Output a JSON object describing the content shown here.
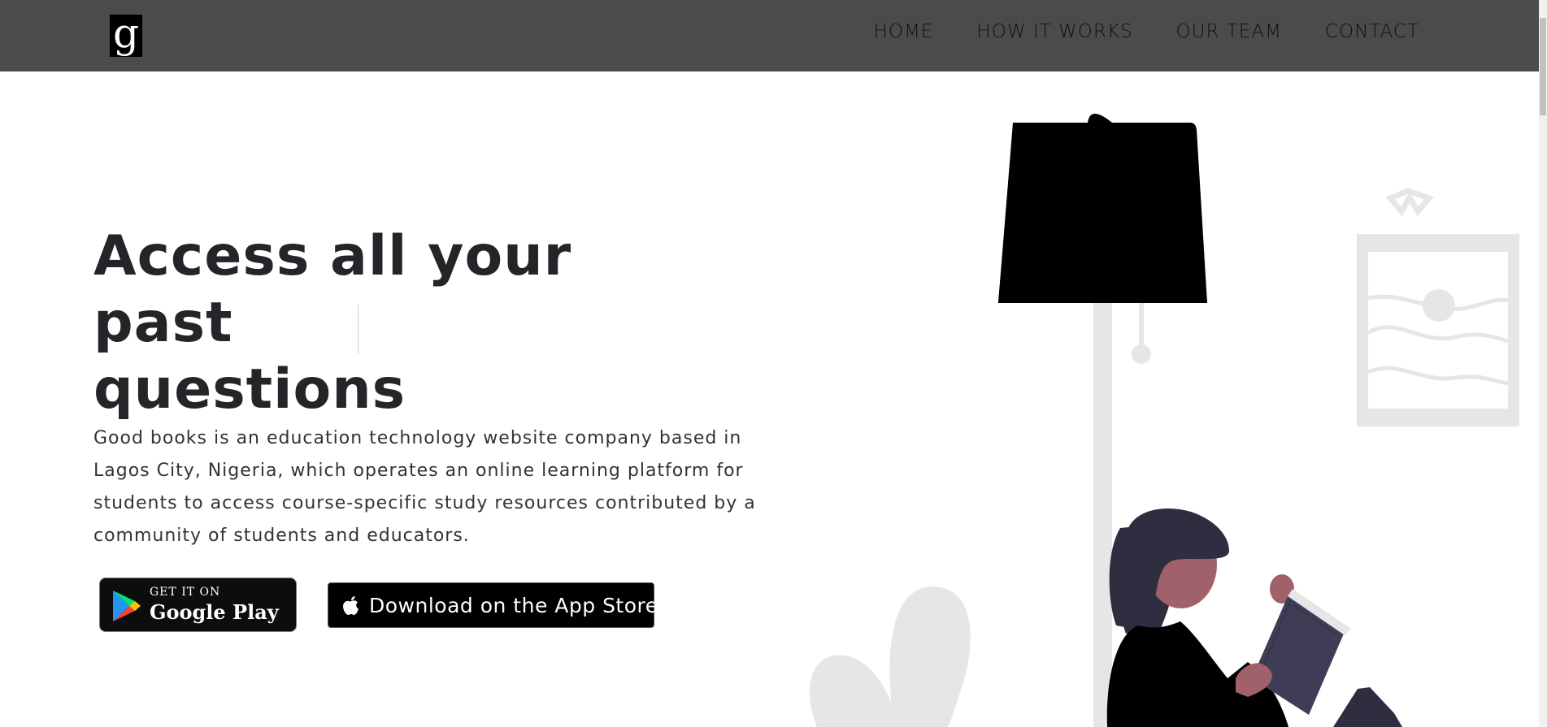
{
  "header": {
    "logo_letter": "g",
    "nav": [
      {
        "label": "HOME"
      },
      {
        "label": "HOW IT WORKS"
      },
      {
        "label": "OUR TEAM"
      },
      {
        "label": "CONTACT"
      }
    ]
  },
  "hero": {
    "title_line1": "Access all your past",
    "title_line2": "questions",
    "description": "Good books is an education technology website company based in Lagos City, Nigeria, which operates an online learning platform for students to access course-specific study resources contributed by a community of students and educators."
  },
  "badges": {
    "google_play": {
      "small": "GET IT ON",
      "big": "Google Play",
      "icon": "google-play-icon"
    },
    "app_store": {
      "label": "Download on the App Store",
      "icon": "apple-icon"
    }
  },
  "colors": {
    "navbar": "#4b4b4b",
    "title": "#232529",
    "illustration_gray": "#e6e6e6",
    "illustration_dark": "#2f2e41",
    "skin": "#a0616a"
  }
}
